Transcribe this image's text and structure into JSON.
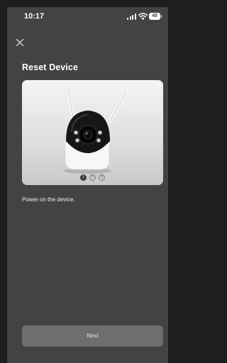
{
  "status_bar": {
    "time": "10:17",
    "battery": "48"
  },
  "header": {
    "close_icon": "close-icon"
  },
  "title": "Reset Device",
  "carousel": {
    "image": "security-camera-photo",
    "pages": [
      "1",
      "2",
      "3"
    ],
    "active_page": 1
  },
  "instruction": "Power on the device.",
  "next_button": {
    "label": "Next"
  },
  "colors": {
    "background": "#434343",
    "button": "#6e6e6e"
  }
}
